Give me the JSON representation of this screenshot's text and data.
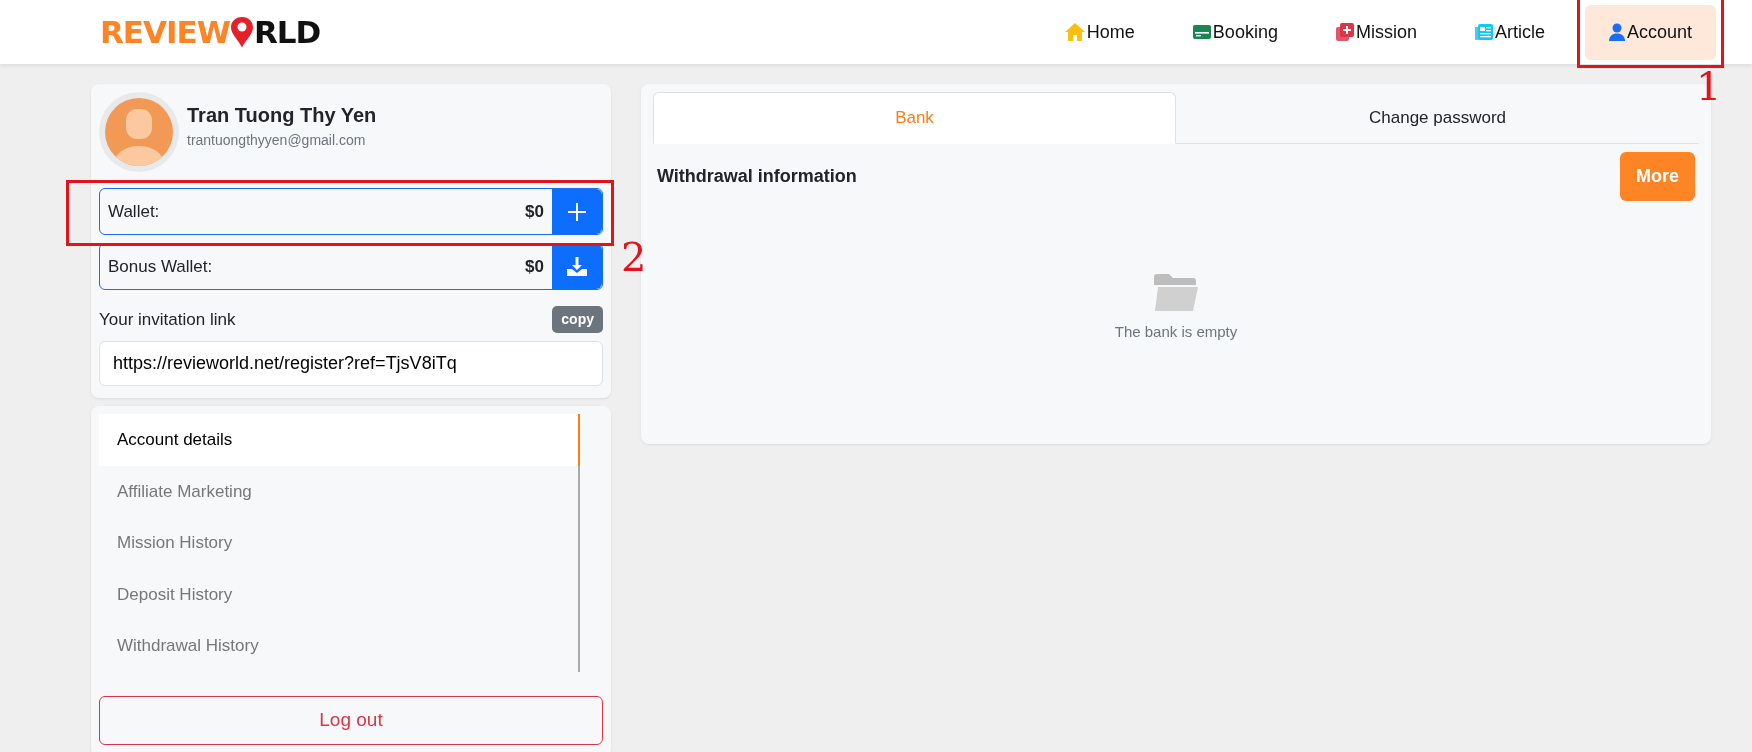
{
  "logo": {
    "part_1": "REVIEW",
    "part_2": "RLD"
  },
  "nav": [
    {
      "label": "Home",
      "selected": false
    },
    {
      "label": "Booking",
      "selected": false
    },
    {
      "label": "Mission",
      "selected": false
    },
    {
      "label": "Article",
      "selected": false
    },
    {
      "label": "Account",
      "selected": true
    }
  ],
  "profile": {
    "name": "Tran Tuong Thy Yen",
    "email": "trantuongthyyen@gmail.com"
  },
  "wallets": [
    {
      "label": "Wallet:",
      "amount": "$0",
      "kind": "add"
    },
    {
      "label": "Bonus Wallet:",
      "amount": "$0",
      "kind": "download"
    }
  ],
  "invitation": {
    "label": "Your invitation link",
    "copy_button": "copy",
    "value": "https://revieworld.net/register?ref=TjsV8iTq"
  },
  "menu": [
    {
      "label": "Account details",
      "selected": true
    },
    {
      "label": "Affiliate Marketing",
      "selected": false
    },
    {
      "label": "Mission History",
      "selected": false
    },
    {
      "label": "Deposit History",
      "selected": false
    },
    {
      "label": "Withdrawal History",
      "selected": false
    }
  ],
  "logout_button": "Log out",
  "tabs": [
    {
      "label": "Bank",
      "selected": true
    },
    {
      "label": "Change password",
      "selected": false
    }
  ],
  "withdrawal": {
    "title": "Withdrawal information",
    "more_button": "More",
    "empty_text": "The bank is empty"
  },
  "annotations": [
    {
      "label": "1"
    },
    {
      "label": "2"
    }
  ]
}
